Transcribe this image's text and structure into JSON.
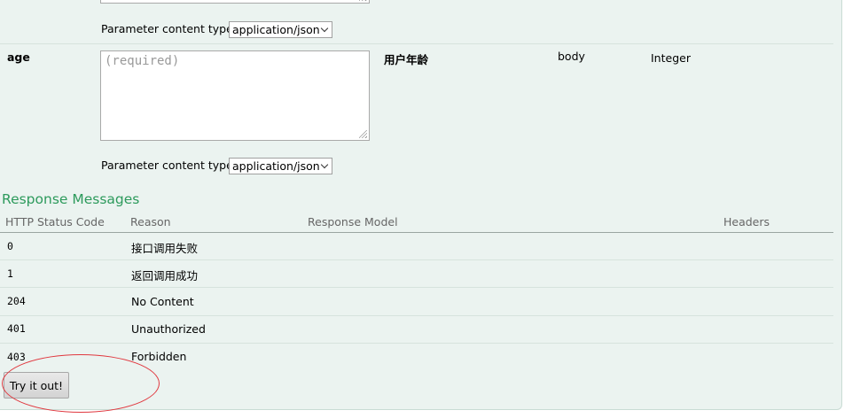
{
  "parameters": {
    "content_type_label": "Parameter content type:",
    "previous": {
      "content_type": "application/json"
    },
    "age": {
      "name": "age",
      "value_placeholder": "(required)",
      "description": "用户年龄",
      "param_type": "body",
      "data_type": "Integer",
      "content_type": "application/json"
    }
  },
  "responses": {
    "title": "Response Messages",
    "columns": [
      "HTTP Status Code",
      "Reason",
      "Response Model",
      "Headers"
    ],
    "rows": [
      {
        "code": "0",
        "reason": "接口调用失败"
      },
      {
        "code": "1",
        "reason": "返回调用成功"
      },
      {
        "code": "204",
        "reason": "No Content"
      },
      {
        "code": "401",
        "reason": "Unauthorized"
      },
      {
        "code": "403",
        "reason": "Forbidden"
      }
    ]
  },
  "try_button": {
    "label": "Try it out!"
  },
  "annotation_color": "#e0383f",
  "accent_color": "#2d9a5c"
}
